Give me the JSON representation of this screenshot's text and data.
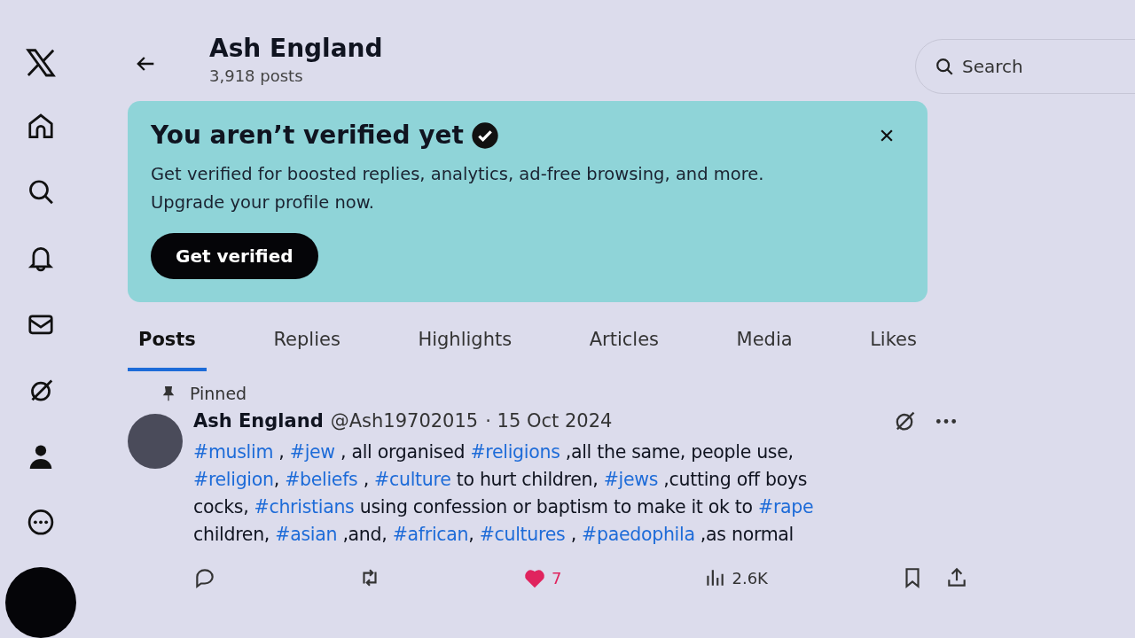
{
  "header": {
    "title": "Ash England",
    "subtitle": "3,918 posts"
  },
  "search": {
    "placeholder": "Search"
  },
  "banner": {
    "title": "You aren’t verified yet",
    "body": "Get verified for boosted replies, analytics, ad-free browsing, and more. Upgrade your profile now.",
    "button": "Get verified"
  },
  "tabs": [
    {
      "label": "Posts",
      "selected": true
    },
    {
      "label": "Replies",
      "selected": false
    },
    {
      "label": "Highlights",
      "selected": false
    },
    {
      "label": "Articles",
      "selected": false
    },
    {
      "label": "Media",
      "selected": false
    },
    {
      "label": "Likes",
      "selected": false
    }
  ],
  "post": {
    "pinned_label": "Pinned",
    "author": "Ash England",
    "handle": "@Ash19702015",
    "date": "· 15 Oct 2024",
    "segments": [
      {
        "kind": "hashtag",
        "text": "#muslim"
      },
      {
        "kind": "text",
        "text": " , "
      },
      {
        "kind": "hashtag",
        "text": "#jew"
      },
      {
        "kind": "text",
        "text": " , all organised "
      },
      {
        "kind": "hashtag",
        "text": "#religions"
      },
      {
        "kind": "text",
        "text": " ,all the same, people use, "
      },
      {
        "kind": "hashtag",
        "text": "#religion"
      },
      {
        "kind": "text",
        "text": ", "
      },
      {
        "kind": "hashtag",
        "text": "#beliefs"
      },
      {
        "kind": "text",
        "text": " , "
      },
      {
        "kind": "hashtag",
        "text": "#culture"
      },
      {
        "kind": "text",
        "text": " to hurt  children, "
      },
      {
        "kind": "hashtag",
        "text": "#jews"
      },
      {
        "kind": "text",
        "text": " ,cutting off boys cocks, "
      },
      {
        "kind": "hashtag",
        "text": "#christians"
      },
      {
        "kind": "text",
        "text": " using confession or baptism to make it ok to "
      },
      {
        "kind": "hashtag",
        "text": "#rape"
      },
      {
        "kind": "text",
        "text": " children, "
      },
      {
        "kind": "hashtag",
        "text": "#asian"
      },
      {
        "kind": "text",
        "text": " ,and, "
      },
      {
        "kind": "hashtag",
        "text": "#african"
      },
      {
        "kind": "text",
        "text": ", "
      },
      {
        "kind": "hashtag",
        "text": "#cultures"
      },
      {
        "kind": "text",
        "text": " , "
      },
      {
        "kind": "hashtag",
        "text": "#paedophila"
      },
      {
        "kind": "text",
        "text": " ,as normal"
      }
    ],
    "liked": true,
    "likes": "7",
    "views": "2.6K"
  }
}
